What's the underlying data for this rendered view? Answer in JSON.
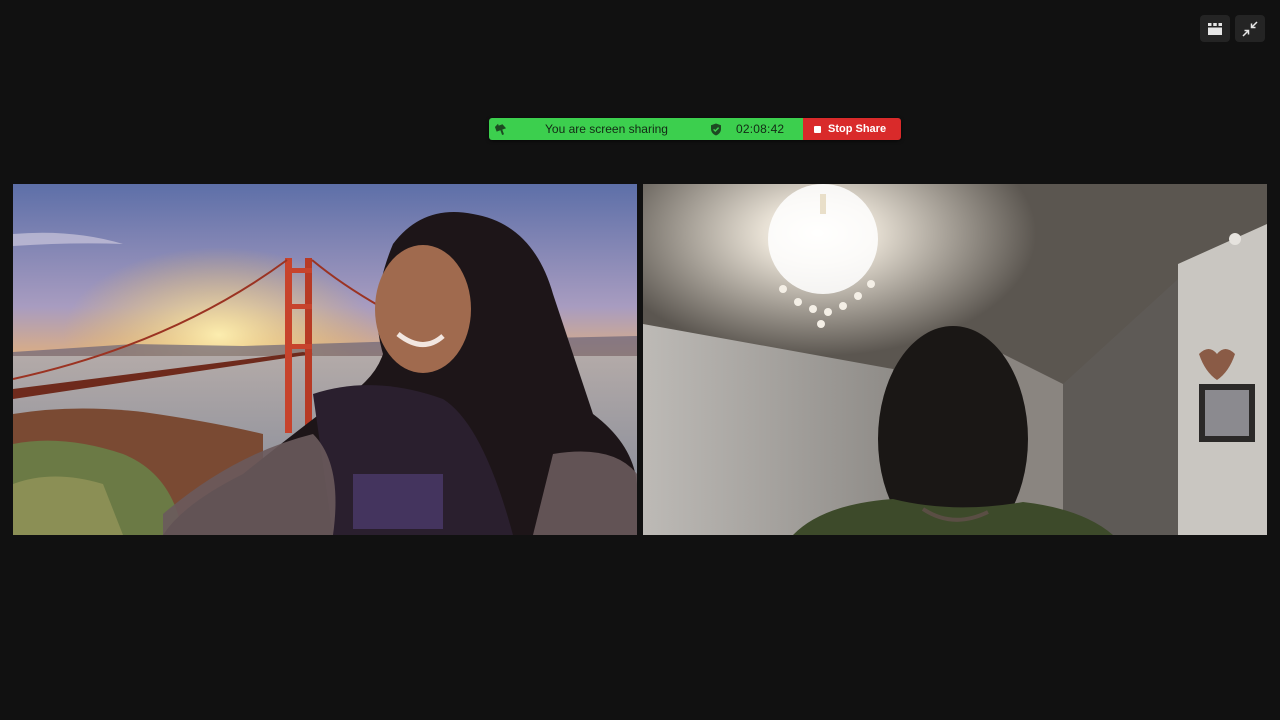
{
  "window_controls": {
    "gallery_view_tooltip": "Gallery View",
    "exit_fullscreen_tooltip": "Exit Full Screen"
  },
  "share_bar": {
    "status_text": "You are screen sharing",
    "timer": "02:08:42",
    "stop_label": "Stop Share",
    "colors": {
      "green": "#3ccf4e",
      "red": "#d92a2a"
    }
  },
  "participants": [
    {
      "id": "participant-1",
      "background": "golden-gate-bridge-virtual-background"
    },
    {
      "id": "participant-2",
      "background": "room-with-chandelier"
    }
  ]
}
